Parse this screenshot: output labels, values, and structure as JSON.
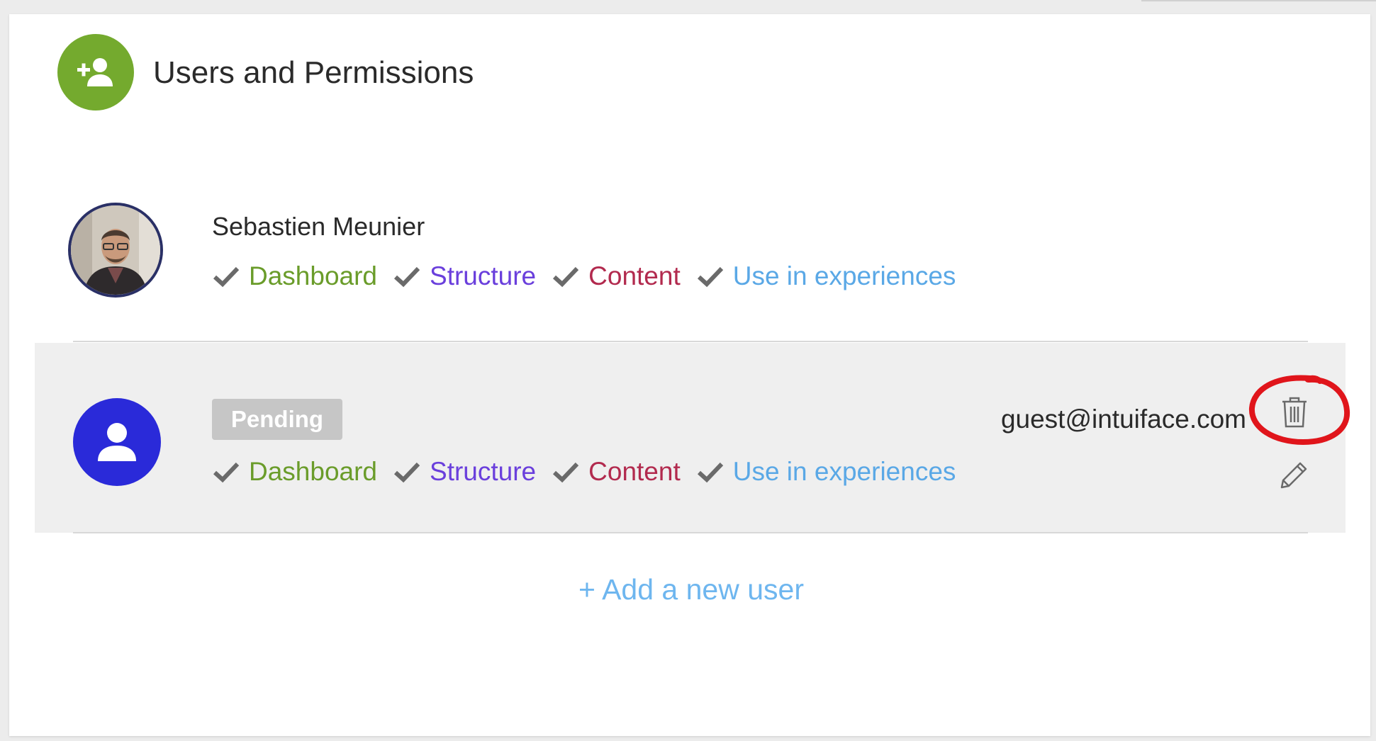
{
  "header": {
    "title": "Users and Permissions",
    "icon": "add-user-icon",
    "icon_color": "#74aa2e"
  },
  "users": [
    {
      "name": "Sebastien Meunier",
      "avatar": "profile-photo",
      "permissions": [
        {
          "label": "Dashboard",
          "color": "#6a9c2a"
        },
        {
          "label": "Structure",
          "color": "#6a3fdc"
        },
        {
          "label": "Content",
          "color": "#b22a4e"
        },
        {
          "label": "Use in experiences",
          "color": "#5aa8e6"
        }
      ]
    },
    {
      "status": "Pending",
      "email": "guest@intuiface.com",
      "avatar": "default-user-icon",
      "avatar_color": "#2a2ad9",
      "permissions": [
        {
          "label": "Dashboard",
          "color": "#6a9c2a"
        },
        {
          "label": "Structure",
          "color": "#6a3fdc"
        },
        {
          "label": "Content",
          "color": "#b22a4e"
        },
        {
          "label": "Use in experiences",
          "color": "#5aa8e6"
        }
      ],
      "actions": {
        "delete_icon": "trash-icon",
        "edit_icon": "pencil-icon"
      }
    }
  ],
  "add_user_label": "+ Add a new user",
  "annotation_color": "#e0151b"
}
